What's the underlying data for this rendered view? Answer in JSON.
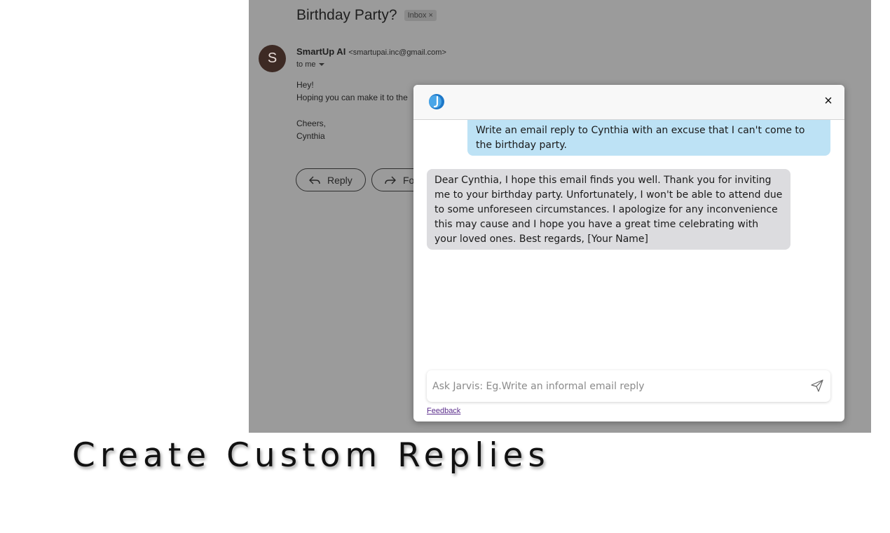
{
  "email": {
    "subject": "Birthday Party?",
    "label": "Inbox",
    "label_close": "×",
    "sender_initial": "S",
    "sender_name": "SmartUp AI",
    "sender_email": "<smartupai.inc@gmail.com>",
    "recipient": "to me",
    "body_lines": [
      "Hey!",
      "Hoping you can make it to the",
      "Cheers,",
      "Cynthia"
    ],
    "reply_label": "Reply",
    "forward_label": "For"
  },
  "jarvis": {
    "close_label": "×",
    "user_message": "Write an email reply to Cynthia with an excuse that I can't come to the birthday party.",
    "assistant_message": "Dear Cynthia, I hope this email finds you well. Thank you for inviting me to your birthday party. Unfortunately, I won't be able to attend due to some unforeseen circumstances. I apologize for any inconvenience this may cause and I hope you have a great time celebrating with your loved ones. Best regards, [Your Name]",
    "input_placeholder": "Ask Jarvis: Eg.Write an informal email reply",
    "feedback_label": "Feedback"
  },
  "caption": "Create Custom Replies",
  "colors": {
    "user_bubble": "#bde2f5",
    "assistant_bubble": "#dcdcdf",
    "logo_blue": "#1e78c8"
  }
}
